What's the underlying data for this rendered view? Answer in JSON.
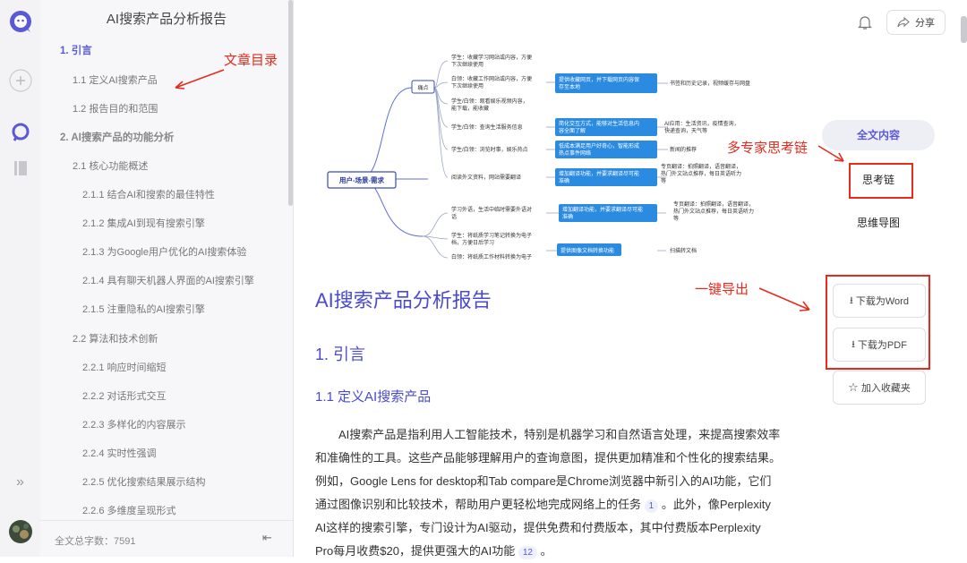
{
  "doc_title": "AI搜索产品分析报告",
  "toc": {
    "items": [
      {
        "label": "1. 引言",
        "level": 1
      },
      {
        "label": "1.1 定义AI搜索产品",
        "level": 2
      },
      {
        "label": "1.2 报告目的和范围",
        "level": 2
      },
      {
        "label": "2. AI搜索产品的功能分析",
        "level": 1
      },
      {
        "label": "2.1 核心功能概述",
        "level": 2
      },
      {
        "label": "2.1.1 结合AI和搜索的最佳特性",
        "level": 3
      },
      {
        "label": "2.1.2 集成AI到现有搜索引擎",
        "level": 3
      },
      {
        "label": "2.1.3 为Google用户优化的AI搜索体验",
        "level": 3
      },
      {
        "label": "2.1.4 具有聊天机器人界面的AI搜索引擎",
        "level": 3
      },
      {
        "label": "2.1.5 注重隐私的AI搜索引擎",
        "level": 3
      },
      {
        "label": "2.2 算法和技术创新",
        "level": 2
      },
      {
        "label": "2.2.1 响应时间缩短",
        "level": 3
      },
      {
        "label": "2.2.2 对话形式交互",
        "level": 3
      },
      {
        "label": "2.2.3 多样化的内容展示",
        "level": 3
      },
      {
        "label": "2.2.4 实时性强调",
        "level": 3
      },
      {
        "label": "2.2.5 优化搜索结果展示结构",
        "level": 3
      },
      {
        "label": "2.2.6 多维度呈现形式",
        "level": 3
      }
    ],
    "word_count": "全文总字数：7591"
  },
  "annotations": {
    "toc": "文章目录",
    "thinking": "多专家思考链",
    "export": "一键导出"
  },
  "mindmap": {
    "root": "用户-场景-需求",
    "pain_point": "痛点",
    "leaves": [
      "学生：收藏学习网站或内容，方便",
      "下次继续使用",
      "白领：收藏工作网站或内容，方便",
      "下次继续使用",
      "学生/白领：观看娱乐视频内容，",
      "能下载，能收藏",
      "学生/白领：查询生活服务信息",
      "学生/白领：浏览时事，娱乐热点",
      "阅读外文资料，网站需要翻译",
      "学习外语，生活中临时需要外语对",
      "话",
      "学生：将纸质学习笔记转换为电子",
      "档，方便日后学习",
      "白领：将纸质工作材料转换为电子"
    ],
    "needs": [
      "提供收藏网页，并下载网页内容保",
      "存至本地",
      "简化交互方式，能够对生活信息内",
      "容全面了解",
      "低成本满足用户好奇心，智能形成",
      "热点事件网络",
      "增加翻译功能，并要求翻译尽可能",
      "准确",
      "增加翻译功能，并要求翻译尽可能",
      "准确",
      "提供图像文档转换功能"
    ],
    "features": [
      "书签和历史记录，视频缓存与网盘",
      "AI应用：生活资讯，疫情查询，",
      "快递查询，天气等",
      "新闻的推荐",
      "专页翻译：拍照翻译，语音翻译，",
      "热门外文站点推荐，每日英语听力",
      "等",
      "专页翻译：拍照翻译，语音翻译，",
      "热门外文站点推荐，每日英语听力",
      "等",
      "扫描转文档"
    ]
  },
  "doc": {
    "h1": "AI搜索产品分析报告",
    "h2": "1. 引言",
    "h3": "1.1 定义AI搜索产品",
    "p1": "AI搜索产品是指利用人工智能技术，特别是机器学习和自然语言处理，来提高搜索效率和准确性的工具。这些产品能够理解用户的查询意图，提供更加精准和个性化的搜索结果。例如，Google Lens for desktop和Tab compare是Chrome浏览器中新引入的AI功能，它们通过图像识别和比较技术，帮助用户更轻松地完成网络上的任务",
    "cite1": "1",
    "p2": "。此外，像Perplexity AI这样的搜索引擎，专门设计为AI驱动，提供免费和付费版本，其中付费版本Perplexity Pro每月收费$20，提供更强大的AI功能",
    "cite2": "12",
    "p3": "。"
  },
  "header": {
    "share": "分享"
  },
  "right_panel": {
    "tabs": [
      "全文内容",
      "思考链",
      "思维导图"
    ],
    "download_word": "下载为Word",
    "download_pdf": "下载为PDF",
    "favorite": "加入收藏夹"
  },
  "colors": {
    "accent": "#5b5ad6",
    "annotation": "#e62b1e",
    "mindmap_box": "#2b8be0"
  }
}
